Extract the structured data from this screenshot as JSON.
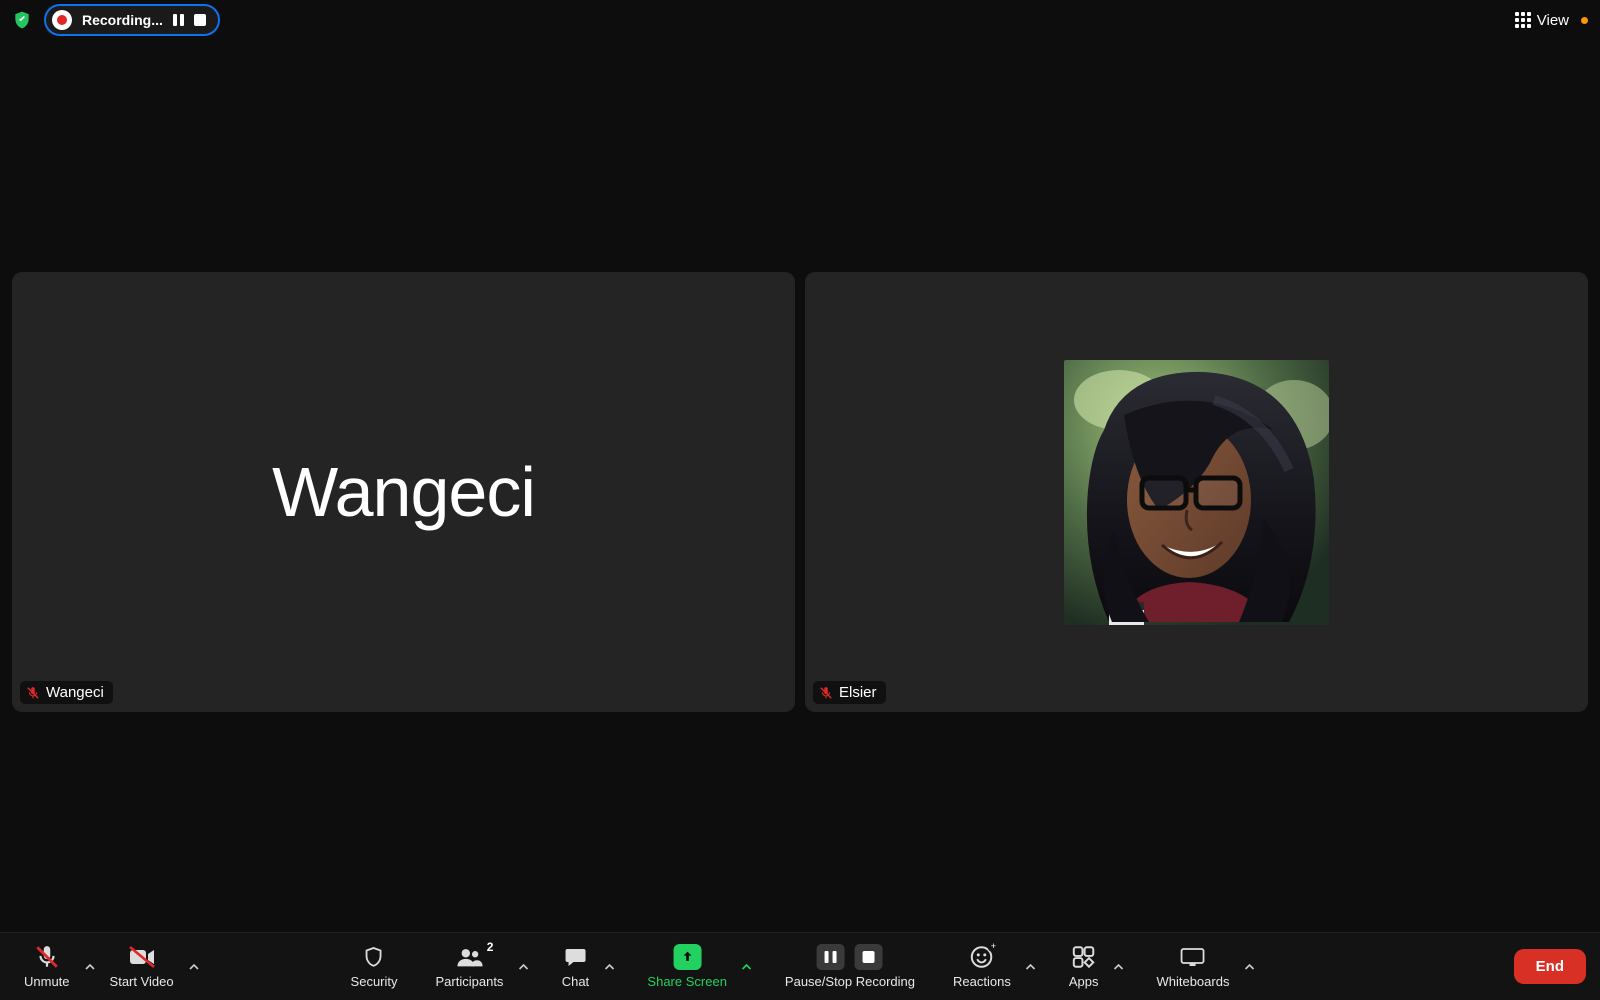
{
  "top": {
    "recording_label": "Recording...",
    "view_label": "View"
  },
  "participants": [
    {
      "display_name": "Wangeci",
      "tag_name": "Wangeci",
      "muted": true,
      "has_avatar": false
    },
    {
      "display_name": "Elsier",
      "tag_name": "Elsier",
      "muted": true,
      "has_avatar": true
    }
  ],
  "toolbar": {
    "unmute": "Unmute",
    "start_video": "Start Video",
    "security": "Security",
    "participants": "Participants",
    "participants_count": "2",
    "chat": "Chat",
    "share_screen": "Share Screen",
    "record": "Pause/Stop Recording",
    "reactions": "Reactions",
    "apps": "Apps",
    "whiteboards": "Whiteboards",
    "end": "End"
  },
  "colors": {
    "accent_blue": "#0e72ed",
    "green": "#23d160",
    "red": "#d93025",
    "rec_red": "#e02828"
  }
}
